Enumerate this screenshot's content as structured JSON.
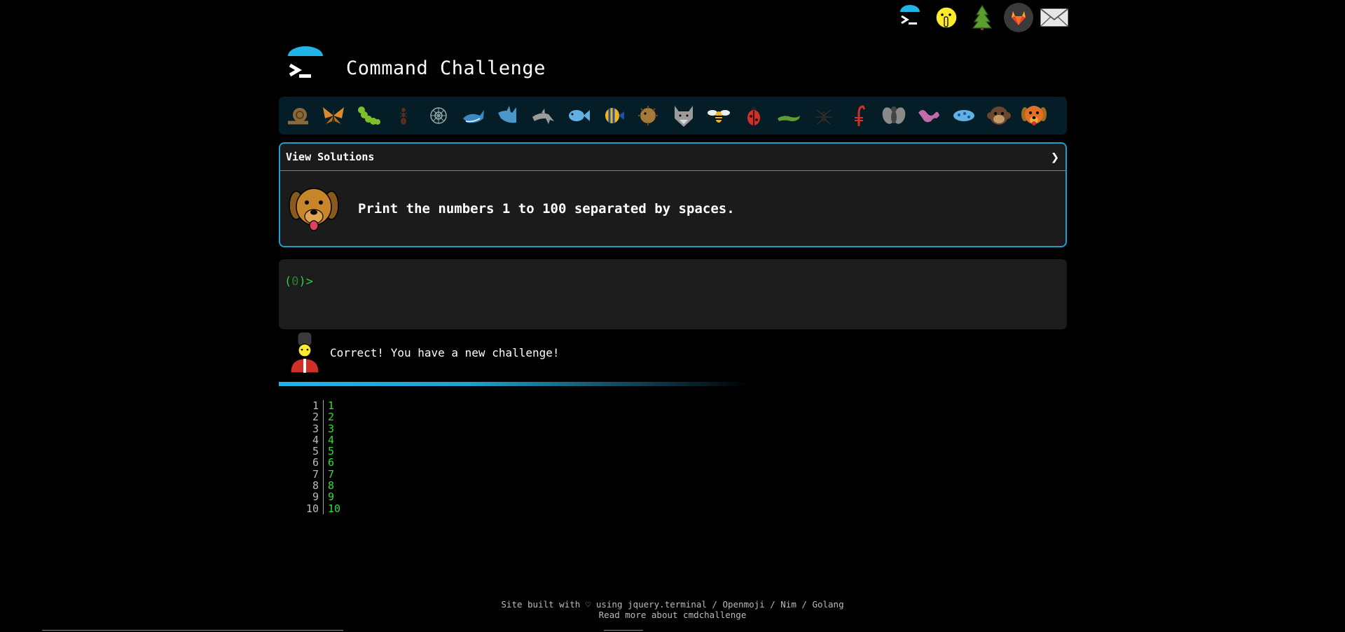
{
  "header": {
    "title": "Command Challenge"
  },
  "topnav": {
    "icons": [
      "terminal-logo-icon",
      "shushing-face-icon",
      "evergreen-tree-icon",
      "gitlab-icon",
      "envelope-icon"
    ]
  },
  "levels": {
    "icons": [
      "snail",
      "butterfly",
      "caterpillar",
      "ant",
      "sand-dollar",
      "whale",
      "shark",
      "dolphin",
      "fish",
      "tropical-fish",
      "blowfish",
      "wolf",
      "bee",
      "ladybug",
      "lizard",
      "spider",
      "scorpion",
      "fly",
      "worm",
      "microbe",
      "monkey",
      "dog"
    ]
  },
  "challenge": {
    "view_solutions_label": "View Solutions",
    "chevron": "❯",
    "text": "Print the numbers 1 to 100 separated by spaces."
  },
  "terminal": {
    "prompt_open": "(",
    "prompt_count": "0",
    "prompt_close": ")>"
  },
  "feedback": {
    "message": "Correct! You have a new challenge!"
  },
  "progress": {
    "fraction": 0.6
  },
  "output": {
    "lines": [
      {
        "n": "1",
        "v": "1"
      },
      {
        "n": "2",
        "v": "2"
      },
      {
        "n": "3",
        "v": "3"
      },
      {
        "n": "4",
        "v": "4"
      },
      {
        "n": "5",
        "v": "5"
      },
      {
        "n": "6",
        "v": "6"
      },
      {
        "n": "7",
        "v": "7"
      },
      {
        "n": "8",
        "v": "8"
      },
      {
        "n": "9",
        "v": "9"
      },
      {
        "n": "10",
        "v": "10"
      }
    ]
  },
  "footer": {
    "line1_prefix": "Site built with ♡ using ",
    "link_jquery": "jquery.terminal",
    "sep1": " / ",
    "link_openmoji": "Openmoji",
    "sep2": " / ",
    "link_nim": "Nim",
    "sep3": " / ",
    "link_golang": "Golang",
    "line2_link": "Read more about cmdchallenge"
  },
  "colors": {
    "accent": "#1f9fca",
    "prompt_green": "#2ecc40",
    "output_green": "#2ee02e",
    "levels_bg": "#041d26",
    "panel_bg": "#1b1b1b"
  }
}
